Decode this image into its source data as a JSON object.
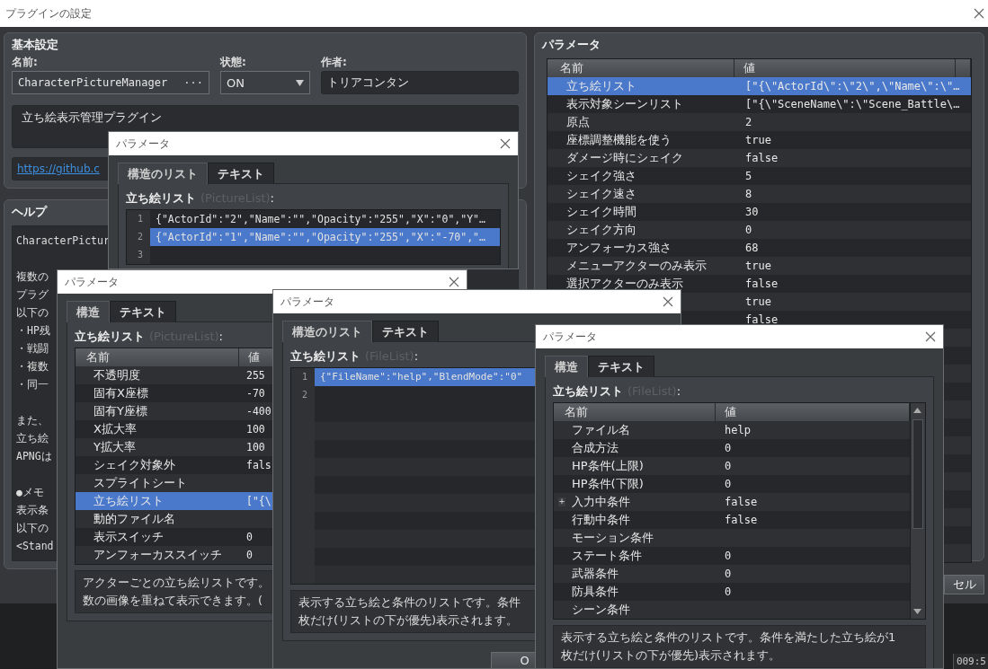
{
  "window": {
    "title": "プラグインの設定"
  },
  "basic_settings": {
    "heading": "基本設定",
    "name_label": "名前:",
    "name_value": "CharacterPictureManager",
    "name_button": "···",
    "status_label": "状態:",
    "status_value": "ON",
    "author_label": "作者:",
    "author_value": "トリアコンタン",
    "description": "立ち絵表示管理プラグイン",
    "url": "https://github.c"
  },
  "help": {
    "heading": "ヘルプ",
    "paragraphs": [
      [
        "CharacterPictur"
      ],
      [
        "複数の",
        "プラグ",
        "以下の",
        "・HP残",
        "・戦闘",
        "・複数",
        "・同一"
      ],
      [
        "また、",
        "立ち絵",
        "APNGは"
      ],
      [
        "●メモ",
        "表示条",
        "以下の",
        "<Stand"
      ]
    ]
  },
  "parameters": {
    "heading": "パラメータ",
    "columns": [
      "名前",
      "値"
    ],
    "rows": [
      {
        "name": "立ち絵リスト",
        "value": "[\"{\\\"ActorId\\\":\\\"2\\\",\\\"Name\\\":\\\"…",
        "selected": true
      },
      {
        "name": "表示対象シーンリスト",
        "value": "[\"{\\\"SceneName\\\":\\\"Scene_Battle\\…",
        "selected": false
      },
      {
        "name": "原点",
        "value": "2",
        "selected": false
      },
      {
        "name": "座標調整機能を使う",
        "value": "true",
        "selected": false
      },
      {
        "name": "ダメージ時にシェイク",
        "value": "false",
        "selected": false
      },
      {
        "name": "シェイク強さ",
        "value": "5",
        "selected": false
      },
      {
        "name": "シェイク速さ",
        "value": "8",
        "selected": false
      },
      {
        "name": "シェイク時間",
        "value": "30",
        "selected": false
      },
      {
        "name": "シェイク方向",
        "value": "0",
        "selected": false
      },
      {
        "name": "アンフォーカス強さ",
        "value": "68",
        "selected": false
      },
      {
        "name": "メニューアクターのみ表示",
        "value": "true",
        "selected": false
      },
      {
        "name": "選択アクターのみ表示",
        "value": "false",
        "selected": false
      },
      {
        "value": "true",
        "selected": false
      },
      {
        "value": "false",
        "selected": false
      }
    ]
  },
  "cancel_button": "セル",
  "status": "009:5",
  "dialogs": [
    {
      "title": "パラメータ",
      "tabs": [
        {
          "label": "構造のリスト",
          "selected": true
        },
        {
          "label": "テキスト",
          "selected": false
        }
      ],
      "field_label": "立ち絵リスト",
      "type_hint": "(PictureList)",
      "separator": ":",
      "content": {
        "kind": "code",
        "lines": [
          {
            "number": "1",
            "text": "{\"ActorId\":\"2\",\"Name\":\"\",\"Opacity\":\"255\",\"X\":\"0\",\"Y\"…",
            "selected": false
          },
          {
            "number": "2",
            "text": "{\"ActorId\":\"1\",\"Name\":\"\",\"Opacity\":\"255\",\"X\":\"-70\",\"…",
            "selected": true
          },
          {
            "number": "3",
            "selected": false
          }
        ]
      }
    },
    {
      "title": "パラメータ",
      "tabs": [
        {
          "label": "構造",
          "selected": true
        },
        {
          "label": "テキスト",
          "selected": false
        }
      ],
      "field_label": "立ち絵リスト",
      "type_hint": "(PictureList)",
      "separator": ":",
      "content": {
        "kind": "table",
        "columns": [
          "名前",
          "値"
        ],
        "rows": [
          {
            "name": "不透明度",
            "value": "255",
            "selected": false
          },
          {
            "name": "固有X座標",
            "value": "-70",
            "selected": false
          },
          {
            "name": "固有Y座標",
            "value": "-400",
            "selected": false
          },
          {
            "name": "X拡大率",
            "value": "100",
            "selected": false
          },
          {
            "name": "Y拡大率",
            "value": "100",
            "selected": false
          },
          {
            "name": "シェイク対象外",
            "value": "fals",
            "selected": false
          },
          {
            "name": "スプライトシート",
            "selected": false
          },
          {
            "name": "立ち絵リスト",
            "value": "[\"{\\",
            "selected": true
          },
          {
            "name": "動的ファイル名",
            "selected": false
          },
          {
            "name": "表示スイッチ",
            "value": "0",
            "selected": false
          },
          {
            "name": "アンフォーカススイッチ",
            "value": "0",
            "selected": false
          }
        ]
      },
      "description": [
        "アクターごとの立ち絵リストです。",
        "数の画像を重ねて表示できます。("
      ]
    },
    {
      "title": "パラメータ",
      "tabs": [
        {
          "label": "構造のリスト",
          "selected": true
        },
        {
          "label": "テキスト",
          "selected": false
        }
      ],
      "field_label": "立ち絵リスト",
      "type_hint": "(FileList)",
      "separator": ":",
      "content": {
        "kind": "code",
        "lines": [
          {
            "number": "1",
            "text": "{\"FileName\":\"help\",\"BlendMode\":\"0\"",
            "selected": true
          },
          {
            "number": "2",
            "selected": false
          }
        ]
      },
      "description": [
        "表示する立ち絵と条件のリストです。条件",
        "枚だけ(リストの下が優先)表示されます。"
      ],
      "buttons": [
        "O"
      ]
    },
    {
      "title": "パラメータ",
      "tabs": [
        {
          "label": "構造",
          "selected": true
        },
        {
          "label": "テキスト",
          "selected": false
        }
      ],
      "field_label": "立ち絵リスト",
      "type_hint": "(FileList)",
      "separator": ":",
      "content": {
        "kind": "table",
        "columns": [
          "名前",
          "値"
        ],
        "rows": [
          {
            "name": "ファイル名",
            "value": "help",
            "selected": false
          },
          {
            "name": "合成方法",
            "value": "0",
            "selected": false
          },
          {
            "name": "HP条件(上限)",
            "value": "0",
            "selected": false
          },
          {
            "name": "HP条件(下限)",
            "value": "0",
            "selected": false
          },
          {
            "name": "入力中条件",
            "value": "false",
            "expander": "+",
            "selected": false
          },
          {
            "name": "行動中条件",
            "value": "false",
            "selected": false
          },
          {
            "name": "モーション条件",
            "selected": false
          },
          {
            "name": "ステート条件",
            "value": "0",
            "selected": false
          },
          {
            "name": "武器条件",
            "value": "0",
            "selected": false
          },
          {
            "name": "防具条件",
            "value": "0",
            "selected": false
          },
          {
            "name": "シーン条件",
            "selected": false
          }
        ]
      },
      "description": [
        "表示する立ち絵と条件のリストです。条件を満たした立ち絵が1",
        "枚だけ(リストの下が優先)表示されます。"
      ]
    }
  ]
}
